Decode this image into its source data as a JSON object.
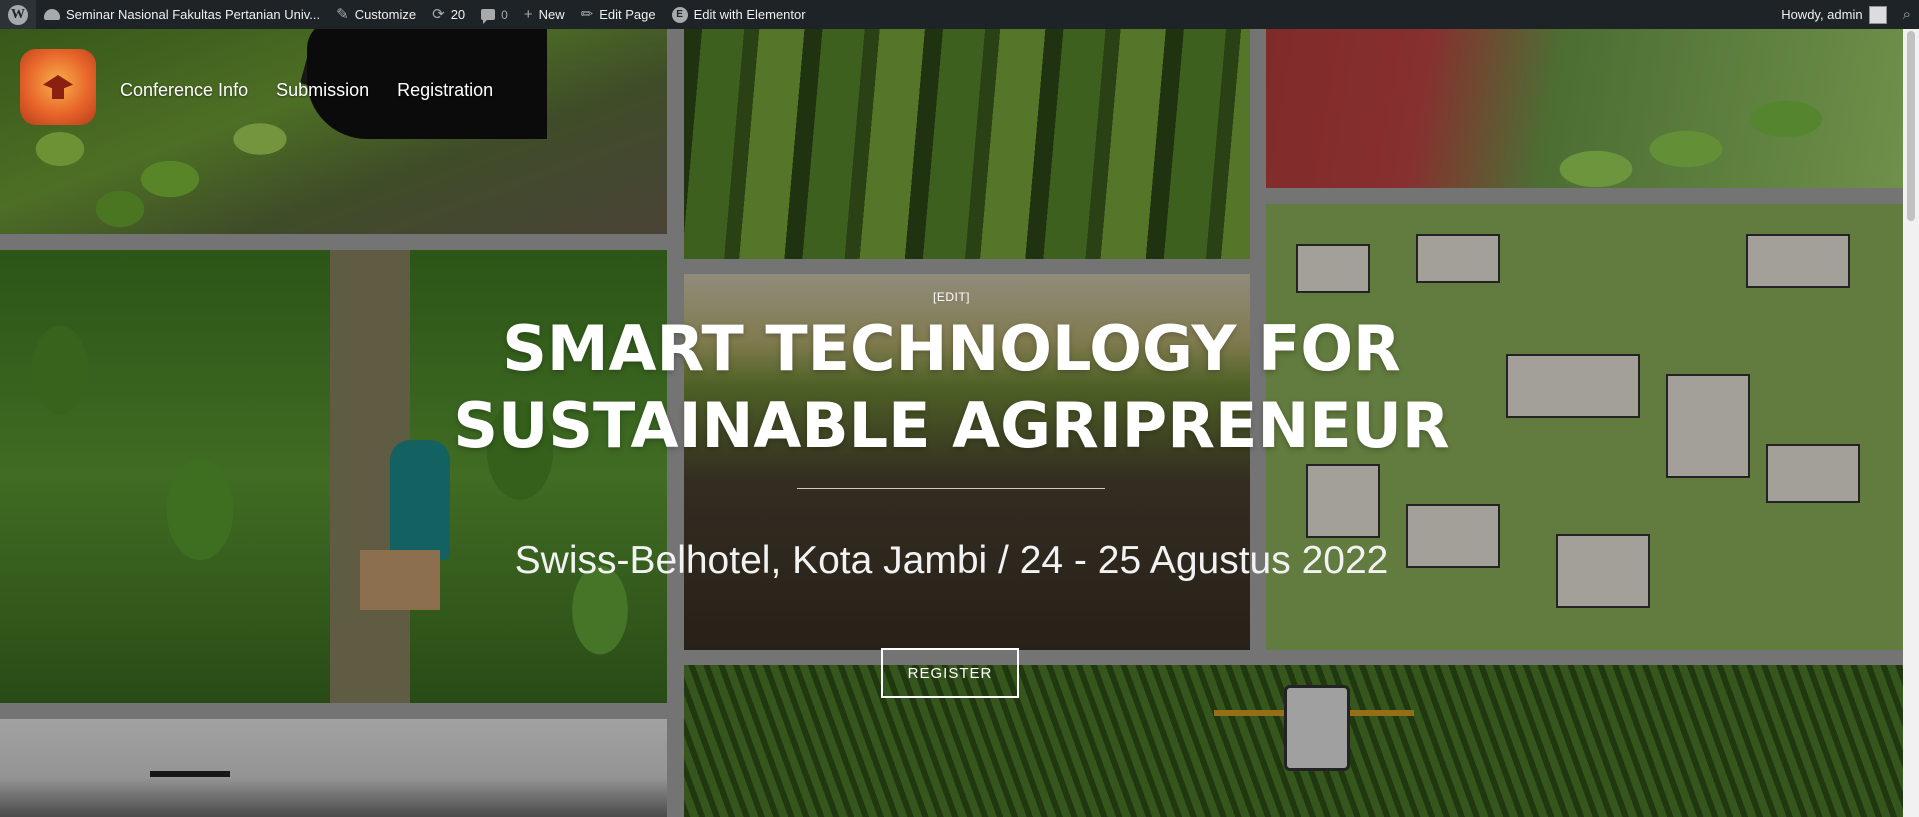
{
  "admin_bar": {
    "site_name": "Seminar Nasional Fakultas Pertanian Univ...",
    "customize": "Customize",
    "updates_count": "20",
    "comments_count": "0",
    "new": "New",
    "edit_page": "Edit Page",
    "edit_elementor": "Edit with Elementor",
    "howdy": "Howdy, admin"
  },
  "nav": {
    "items": [
      {
        "label": "Conference Info"
      },
      {
        "label": "Submission"
      },
      {
        "label": "Registration"
      }
    ]
  },
  "hero": {
    "edit_link": "[EDIT]",
    "title_line1": "SMART TECHNOLOGY FOR",
    "title_line2": "SUSTAINABLE AGRIPRENEUR",
    "subtitle": "Swiss-Belhotel, Kota Jambi / 24 - 25 Agustus 2022",
    "register_label": "REGISTER"
  },
  "colors": {
    "admin_bar_bg": "#1d2327",
    "hero_text": "#ffffff",
    "logo_orange": "#e8652a"
  }
}
